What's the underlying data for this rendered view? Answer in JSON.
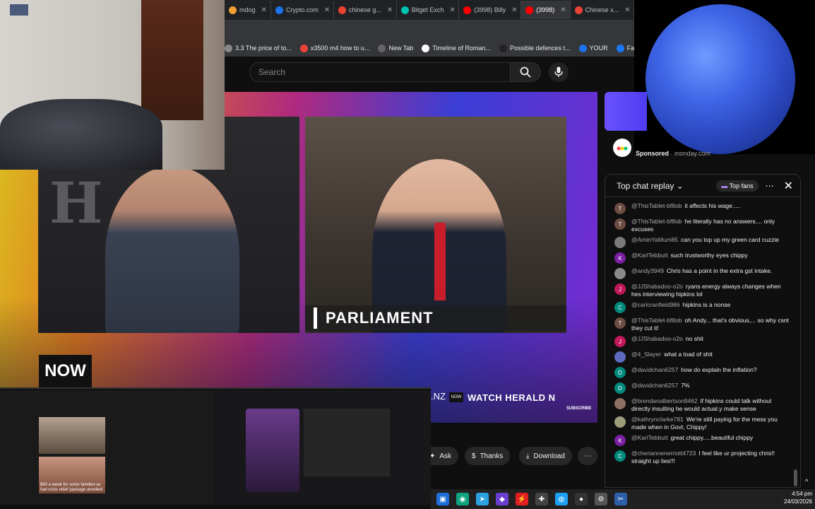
{
  "browser": {
    "tabs": [
      {
        "label": "mdog",
        "color": "#f0a030"
      },
      {
        "label": "Crypto.com",
        "color": "#1a73e8"
      },
      {
        "label": "chinese g...",
        "color": "#ea4335"
      },
      {
        "label": "Bitget Exch",
        "color": "#00c2b2"
      },
      {
        "label": "(3998) Billy",
        "color": "#ff0000"
      },
      {
        "label": "(3998)",
        "color": "#ff0000"
      },
      {
        "label": "Chinese x...",
        "color": "#ea4335"
      }
    ],
    "bookmarks": [
      {
        "label": "3.3 The price of to...",
        "color": "#888888"
      },
      {
        "label": "x3500 m4 how to u...",
        "color": "#ea4335"
      },
      {
        "label": "New Tab",
        "color": "#666666"
      },
      {
        "label": "Timeline of Roman...",
        "color": "#ffffff"
      },
      {
        "label": "Possible defences t...",
        "color": "#222222"
      },
      {
        "label": "YOUR",
        "color": "#1a73e8"
      },
      {
        "label": "Facebook green",
        "color": "#1877f2"
      }
    ]
  },
  "youtube": {
    "search_placeholder": "Search"
  },
  "video": {
    "lower_third": "PARLIAMENT",
    "now_badge": "NOW",
    "nz_text": ".NZ",
    "watch_text": "WATCH HERALD N",
    "subscribe": "SUBSCRIBE"
  },
  "sponsor": {
    "label": "Sponsored",
    "domain": "monday.com"
  },
  "chat": {
    "title": "Top chat replay",
    "top_fans": "Top fans",
    "messages": [
      {
        "user": "@ThisTablet-bf8ob",
        "text": "it affects his wage.....",
        "initial": "T",
        "color": "#6d4c41"
      },
      {
        "user": "@ThisTablet-bf8ob",
        "text": "he literally has no answers.... only excuses",
        "initial": "T",
        "color": "#6d4c41"
      },
      {
        "user": "@AminYaMum85",
        "text": "can you top up my green card cuzzie",
        "initial": "",
        "color": "#7a7a7a"
      },
      {
        "user": "@KarlTebbutt",
        "text": "such trustworthy eyes chippy",
        "initial": "K",
        "color": "#7b1fa2"
      },
      {
        "user": "@andy3949",
        "text": "Chris has a point in the extra gst intake.",
        "initial": "",
        "color": "#8a8a8a"
      },
      {
        "user": "@JJShabadoo-o2o",
        "text": "ryans energy always changes when hes interviewing hipkins lol",
        "initial": "J",
        "color": "#c2185b"
      },
      {
        "user": "@carlcranfield986",
        "text": "hipkins is a nonse",
        "initial": "C",
        "color": "#00897b"
      },
      {
        "user": "@ThisTablet-bf8ob",
        "text": "oh Andy... that's obvious,... so why csnt they cut it!",
        "initial": "T",
        "color": "#6d4c41"
      },
      {
        "user": "@JJShabadoo-o2o",
        "text": "no shit",
        "initial": "J",
        "color": "#c2185b"
      },
      {
        "user": "@4_Slayer",
        "text": "what a load of shit",
        "initial": "",
        "color": "#5c6bc0"
      },
      {
        "user": "@davidchan6257",
        "text": "how do explain the inflation?",
        "initial": "D",
        "color": "#00897b"
      },
      {
        "user": "@davidchan6257",
        "text": "7%",
        "initial": "D",
        "color": "#00897b"
      },
      {
        "user": "@brendanalbertson9462",
        "text": "if hipkins could talk without directly insulting he would actual.y make sense",
        "initial": "",
        "color": "#8d6e63"
      },
      {
        "user": "@kathryncIarke781",
        "text": "We're still paying for the mess you made when in Govt, Chippy!",
        "initial": "",
        "color": "#9e9d7a"
      },
      {
        "user": "@KarlTebbutt",
        "text": "great chippy.....beautiful chippy",
        "initial": "K",
        "color": "#7b1fa2"
      },
      {
        "user": "@cheriannenerriott4723",
        "text": "I feel like ur projecting chris!! straight up lies!!!",
        "initial": "C",
        "color": "#00897b"
      }
    ]
  },
  "actions": {
    "ask": "Ask",
    "thanks": "Thanks",
    "download": "Download"
  },
  "mini": {
    "caption": "$50 a week for some families as fuel crisis relief package unveiled"
  },
  "taskbar": {
    "time": "4:54 pm",
    "date": "24/03/2026"
  }
}
